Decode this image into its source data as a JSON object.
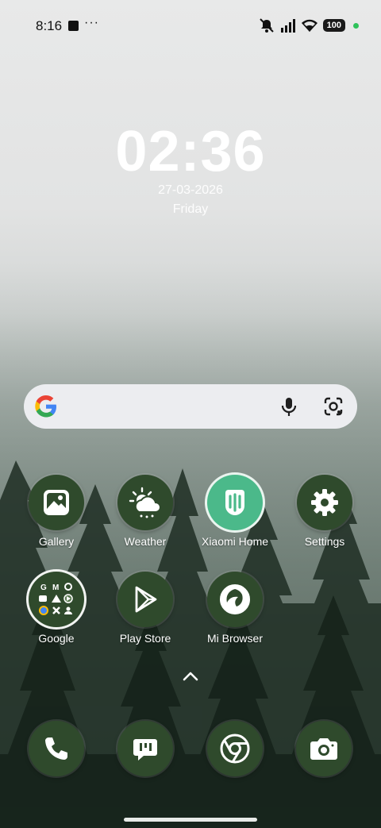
{
  "status_bar": {
    "time": "8:16",
    "overflow": "···",
    "battery": "100",
    "icons": [
      "notification-icon",
      "mute-icon",
      "signal-icon",
      "wifi-icon",
      "battery-icon",
      "privacy-dot-icon"
    ]
  },
  "clock": {
    "time": "02:36",
    "date": "27-03-2026",
    "weekday": "Friday"
  },
  "search": {
    "icons": [
      "google-logo-icon",
      "microphone-icon",
      "lens-icon"
    ]
  },
  "apps": [
    {
      "label": "Gallery",
      "icon": "gallery-icon"
    },
    {
      "label": "Weather",
      "icon": "weather-icon"
    },
    {
      "label": "Xiaomi Home",
      "icon": "xiaomi-home-icon"
    },
    {
      "label": "Settings",
      "icon": "settings-icon"
    },
    {
      "label": "Google",
      "icon": "folder-icon"
    },
    {
      "label": "Play Store",
      "icon": "play-store-icon"
    },
    {
      "label": "Mi Browser",
      "icon": "browser-icon"
    }
  ],
  "dock": [
    "phone-icon",
    "messages-icon",
    "chrome-icon",
    "camera-icon"
  ],
  "colors": {
    "icon_bg": "#2f4a2c",
    "xiaomi_green": "#4bb98a",
    "search_bg": "#ecedf0"
  }
}
